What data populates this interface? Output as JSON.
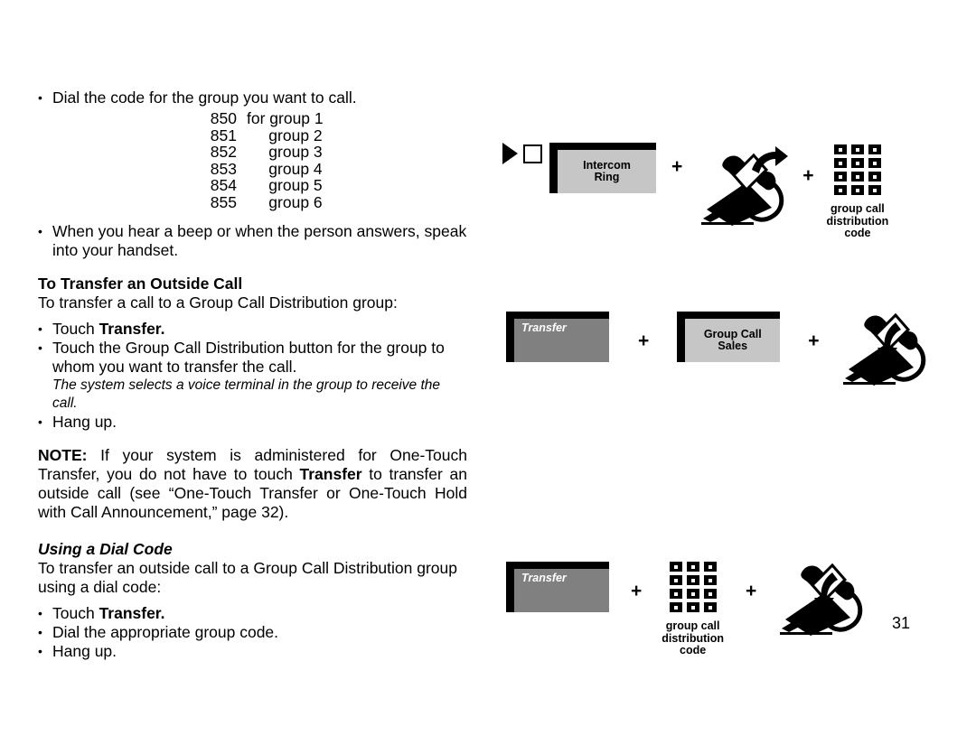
{
  "page": {
    "number": "31"
  },
  "content": {
    "dial_bullet": "Dial the code for the group you want to call.",
    "codes": [
      {
        "num": "850",
        "label": "for group 1"
      },
      {
        "num": "851",
        "label": "     group 2"
      },
      {
        "num": "852",
        "label": "     group 3"
      },
      {
        "num": "853",
        "label": "     group 4"
      },
      {
        "num": "854",
        "label": "     group 5"
      },
      {
        "num": "855",
        "label": "     group 6"
      }
    ],
    "beep_bullet": "When you hear a beep or when the person answers, speak into your handset.",
    "transfer_heading": "To Transfer an Outside Call",
    "transfer_intro": "To transfer a call to a Group Call Distribution group:",
    "touch_transfer_prefix": "Touch ",
    "touch_transfer_bold": "Transfer.",
    "touch_gcd_bullet": "Touch the Group Call Distribution button for the group to whom you want to transfer the call.",
    "system_selects_italic": "The system selects a voice terminal in the group to receive the call.",
    "hang_up_bullet": "Hang up.",
    "note_label": "NOTE:",
    "note_part1": " If your system is administered for One-Touch Transfer, you do not have to touch ",
    "note_bold": "Transfer",
    "note_part2": " to transfer an outside call (see “One-Touch Transfer or One-Touch Hold with Call Announcement,” page 32).",
    "dialcode_heading": "Using a Dial Code",
    "dialcode_intro": "To transfer an outside call to a Group Call Distribution group using a dial code:",
    "dial_group_code_bullet": "Dial the appropriate group code.",
    "bullet_glyph": "•"
  },
  "illustrations": {
    "plus": "+",
    "row1": {
      "ring_symbol_name": "intercom-ring-symbol",
      "button_label": "Intercom\nRing",
      "button_line1": "Intercom",
      "button_line2": "Ring",
      "handset_action": "lift-handset",
      "keypad_caption": "group call\ndistribution\ncode"
    },
    "row2": {
      "transfer_button_label": "Transfer",
      "group_button_line1": "Group Call",
      "group_button_line2": "Sales",
      "handset_action": "hang-up-handset"
    },
    "row3": {
      "transfer_button_label": "Transfer",
      "keypad_caption": "group call\ndistribution\ncode",
      "handset_action": "hang-up-handset"
    }
  },
  "colors": {
    "button_light": "#c6c6c6",
    "button_dark": "#808080",
    "ink": "#000000",
    "paper": "#ffffff"
  }
}
